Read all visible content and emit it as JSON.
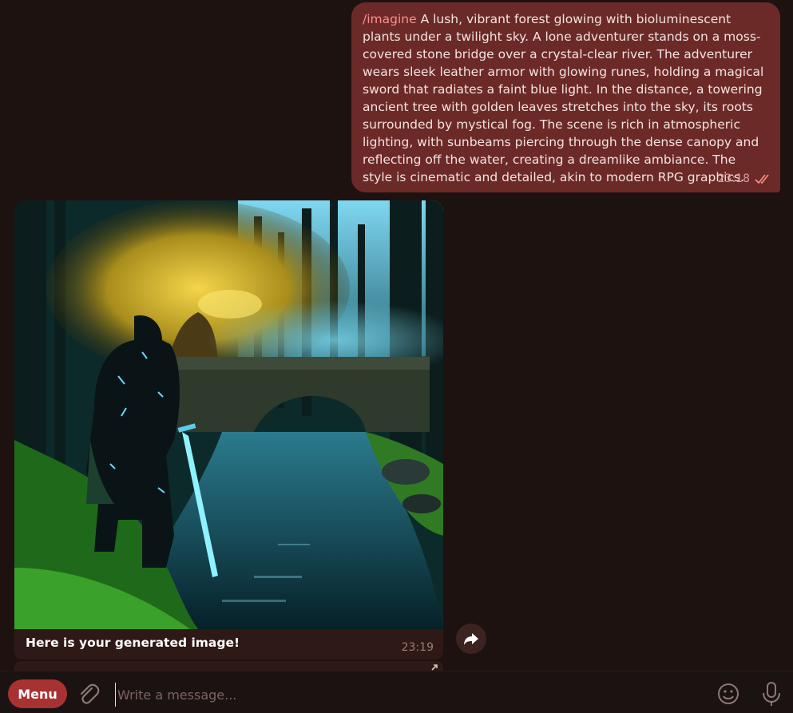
{
  "outgoing": {
    "command": "/imagine",
    "text": " A lush, vibrant forest glowing with bioluminescent plants under a twilight sky. A lone adventurer stands on a moss-covered stone bridge over a crystal-clear river. The adventurer wears sleek leather armor with glowing runes, holding a magical sword that radiates a faint blue light. In the distance, a towering ancient tree with golden leaves stretches into the sky, its roots surrounded by mystical fog. The scene is rich in atmospheric lighting, with sunbeams piercing through the dense canopy and reflecting off the water, creating a dreamlike ambiance. The style is cinematic and detailed, akin to modern RPG graphics.",
    "time": "23:18",
    "status_icon": "double-check-icon"
  },
  "incoming": {
    "caption": "Here is your generated image!",
    "time": "23:19"
  },
  "composer": {
    "menu_label": "Menu",
    "placeholder": "Write a message..."
  },
  "colors": {
    "outgoing_bubble": "#6b2a27",
    "command_accent": "#ff8f8a",
    "menu_button": "#a83232",
    "background": "#1e1210"
  }
}
